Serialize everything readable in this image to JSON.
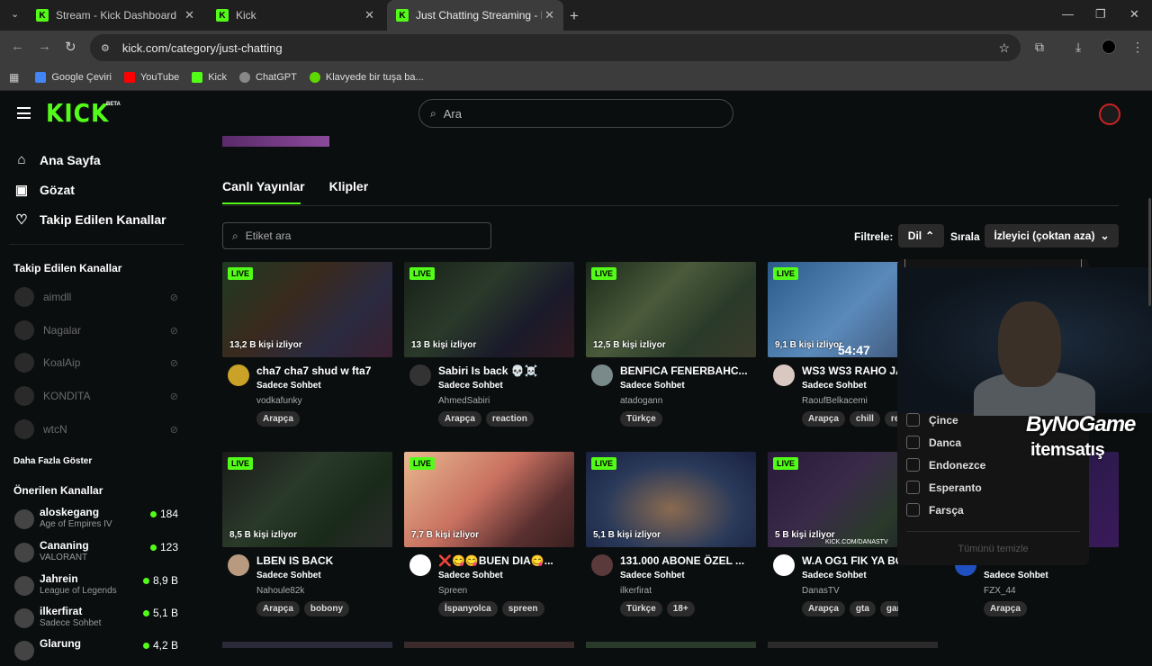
{
  "browser": {
    "tabs": [
      {
        "title": "Stream - Kick Dashboard"
      },
      {
        "title": "Kick"
      },
      {
        "title": "Just Chatting Streaming - Live S"
      }
    ],
    "url": "kick.com/category/just-chatting",
    "bookmarks": [
      {
        "label": "Google Çeviri",
        "color": "#4285f4"
      },
      {
        "label": "YouTube",
        "color": "#ff0000"
      },
      {
        "label": "Kick",
        "color": "#53fc18"
      },
      {
        "label": "ChatGPT",
        "color": "#888888"
      },
      {
        "label": "Klavyede bir tuşa ba...",
        "color": "#5fd700"
      }
    ]
  },
  "header": {
    "logo": "KICK",
    "beta": "BETA",
    "search_placeholder": "Ara"
  },
  "sidebar": {
    "nav": [
      {
        "label": "Ana Sayfa",
        "icon": "home-icon"
      },
      {
        "label": "Gözat",
        "icon": "browse-icon"
      },
      {
        "label": "Takip Edilen Kanallar",
        "icon": "heart-icon"
      }
    ],
    "followed_title": "Takip Edilen Kanallar",
    "followed": [
      "aimdll",
      "Nagalar",
      "KoalAip",
      "KONDITA",
      "wtcN"
    ],
    "show_more": "Daha Fazla Göster",
    "recommended_title": "Önerilen Kanallar",
    "recommended": [
      {
        "name": "aloskegang",
        "category": "Age of Empires IV",
        "viewers": "184"
      },
      {
        "name": "Cananing",
        "category": "VALORANT",
        "viewers": "123"
      },
      {
        "name": "Jahrein",
        "category": "League of Legends",
        "viewers": "8,9 B"
      },
      {
        "name": "ilkerfirat",
        "category": "Sadece Sohbet",
        "viewers": "5,1 B"
      },
      {
        "name": "Glarung",
        "category": "",
        "viewers": "4,2 B"
      }
    ]
  },
  "main": {
    "tabs": [
      "Canlı Yayınlar",
      "Klipler"
    ],
    "tag_search_placeholder": "Etiket ara",
    "filter_label": "Filtrele:",
    "filter_value": "Dil",
    "sort_label": "Sırala",
    "sort_value": "İzleyici (çoktan aza)",
    "live_label": "LIVE",
    "cards": [
      {
        "viewers": "13,2 B kişi izliyor",
        "title": "cha7 cha7 shud w fta7",
        "category": "Sadece Sohbet",
        "streamer": "vodkafunky",
        "tags": [
          "Arapça"
        ]
      },
      {
        "viewers": "13 B kişi izliyor",
        "title": "Sabiri Is back 💀☠️",
        "category": "Sadece Sohbet",
        "streamer": "AhmedSabiri",
        "tags": [
          "Arapça",
          "reaction"
        ]
      },
      {
        "viewers": "12,5 B kişi izliyor",
        "title": "BENFICA FENERBAHC...",
        "category": "Sadece Sohbet",
        "streamer": "atadogann",
        "tags": [
          "Türkçe"
        ]
      },
      {
        "viewers": "9,1 B kişi izliyor",
        "title": "WS3 WS3 RAHO JA",
        "category": "Sadece Sohbet",
        "streamer": "RaoufBelkacemi",
        "tags": [
          "Arapça",
          "chill",
          "rea"
        ]
      },
      {
        "viewers": "8,5 B kişi izliyor",
        "title": "LBEN IS BACK",
        "category": "Sadece Sohbet",
        "streamer": "Nahoule82k",
        "tags": [
          "Arapça",
          "bobony"
        ]
      },
      {
        "viewers": "7,7 B kişi izliyor",
        "title": "❌😋😋BUEN DIA😋...",
        "category": "Sadece Sohbet",
        "streamer": "Spreen",
        "tags": [
          "İspanyolca",
          "spreen"
        ]
      },
      {
        "viewers": "5,1 B kişi izliyor",
        "title": "131.000 ABONE ÖZEL ...",
        "category": "Sadece Sohbet",
        "streamer": "ilkerfirat",
        "tags": [
          "Türkçe",
          "18+"
        ]
      },
      {
        "viewers": "5 B kişi izliyor",
        "title": "W.A OG1 FIK YA BO",
        "category": "Sadece Sohbet",
        "streamer": "DanasTV",
        "tags": [
          "Arapça",
          "gta",
          "gaming"
        ]
      },
      {
        "viewers": "",
        "title": "",
        "category": "Sadece Sohbet",
        "streamer": "FZX_44",
        "tags": [
          "Arapça"
        ]
      }
    ],
    "timestamp_overlay": "54:47",
    "thumb_caption": "KICK.COM/DANASTV"
  },
  "language_dropdown": {
    "items": [
      "Çince",
      "Danca",
      "Endonezce",
      "Esperanto",
      "Farsça"
    ],
    "clear_all": "Tümünü temizle"
  },
  "overlay": {
    "brand1": "ByNoGame",
    "brand2": "itemsatış"
  },
  "colors": {
    "accent": "#53fc18",
    "background": "#0b0e0f"
  }
}
